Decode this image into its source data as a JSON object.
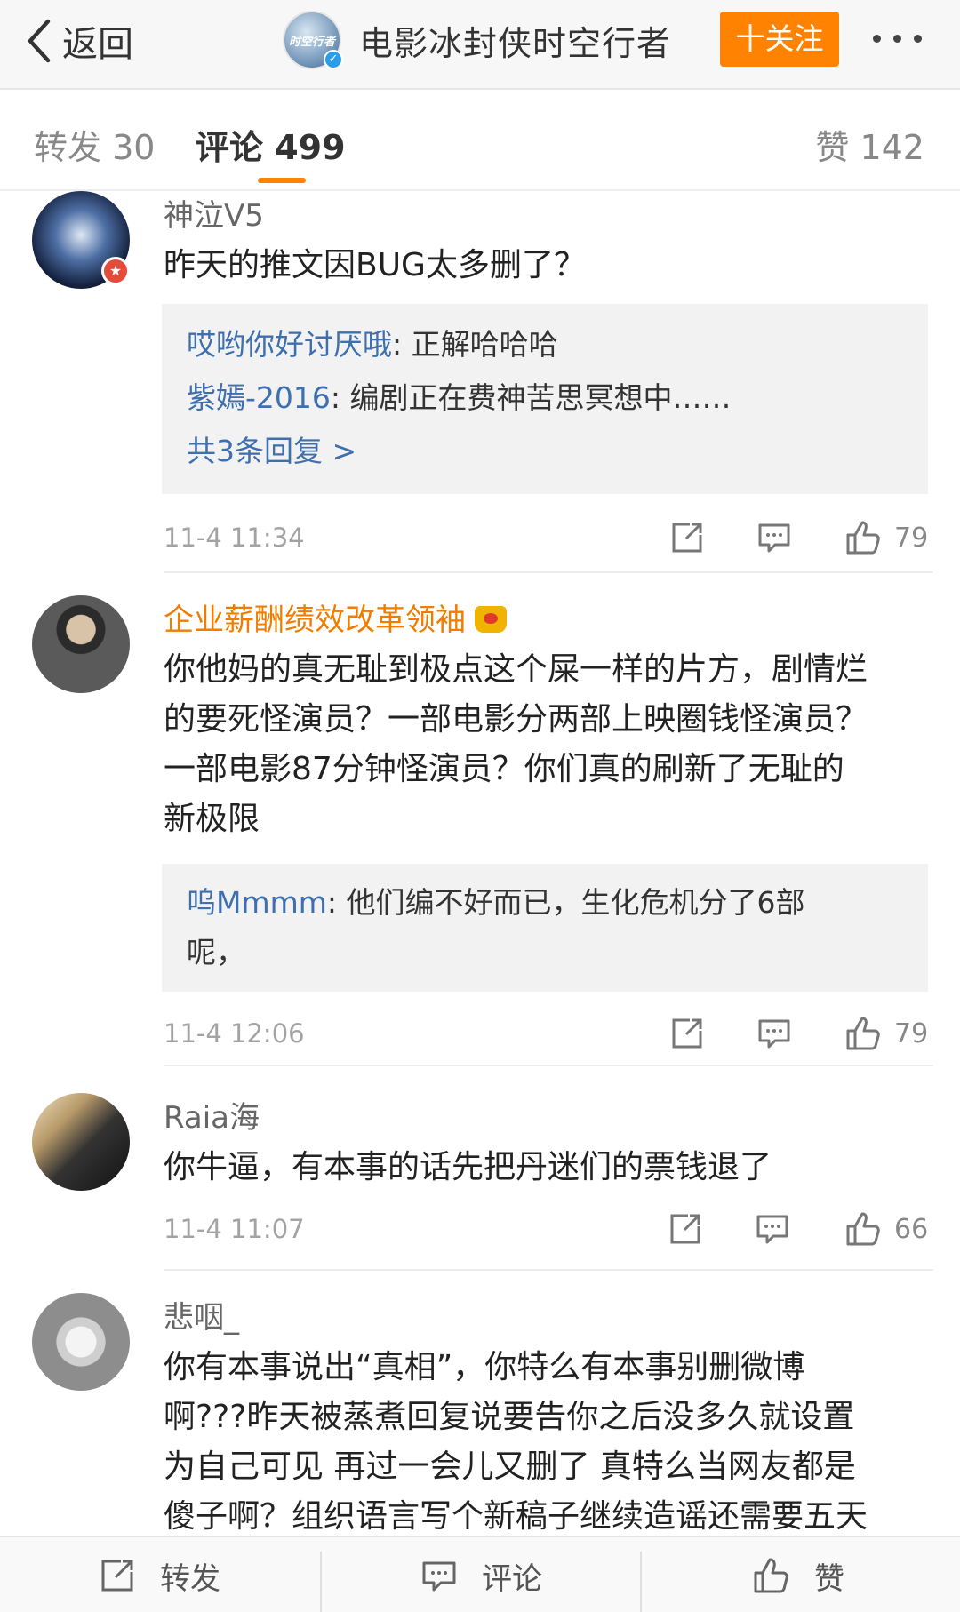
{
  "nav": {
    "back_label": "返回",
    "account_name": "电影冰封侠时空行者",
    "avatar_text": "时空行者",
    "follow_label": "十关注"
  },
  "tabs": {
    "repost": "转发 30",
    "comments": "评论 499",
    "likes": "赞 142"
  },
  "comments": [
    {
      "user": "神泣V5",
      "text": "昨天的推文因BUG太多删了？",
      "replies": [
        {
          "user": "哎哟你好讨厌哦",
          "text": ": 正解哈哈哈"
        },
        {
          "user": "紫嫣-2016",
          "text": ": 编剧正在费神苦思冥想中……"
        }
      ],
      "more_replies": "共3条回复 >",
      "time": "11-4 11:34",
      "likes": "79"
    },
    {
      "user": "企业薪酬绩效改革领袖",
      "text_lines": [
        "你他妈的真无耻到极点这个屎一样的片方，剧情烂",
        "的要死怪演员？一部电影分两部上映圈钱怪演员？",
        "一部电影87分钟怪演员？你们真的刷新了无耻的",
        "新极限"
      ],
      "reply": {
        "user": "呜Mmmm",
        "text_line1": ": 他们编不好而已，生化危机分了6部",
        "text_line2": "呢，"
      },
      "time": "11-4 12:06",
      "likes": "79"
    },
    {
      "user": "Raia海",
      "text": "你牛逼，有本事的话先把丹迷们的票钱退了",
      "time": "11-4 11:07",
      "likes": "66"
    },
    {
      "user": "悲咽_",
      "text_lines": [
        "你有本事说出“真相”，你特么有本事别删微博",
        "啊???昨天被蒸煮回复说要告你之后没多久就设置",
        "为自己可见 再过一会儿又删了 真特么当网友都是",
        "傻子啊？组织语言写个新稿子继续造谣还需要五天"
      ]
    }
  ],
  "bottom": {
    "repost": "转发",
    "comment": "评论",
    "like": "赞"
  },
  "colors": {
    "accent": "#ff8200",
    "link": "#3e6fae",
    "vip_name": "#f07d00"
  }
}
